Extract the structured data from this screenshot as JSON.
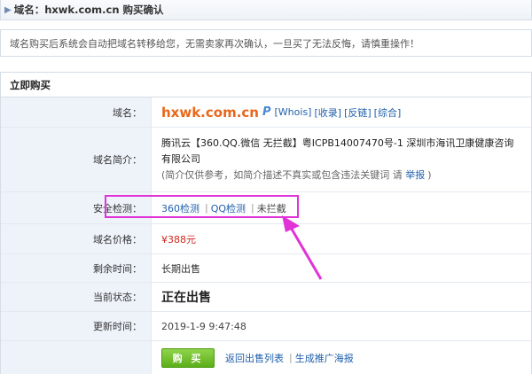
{
  "header": {
    "title": "域名：hxwk.com.cn 购买确认"
  },
  "notice": "域名购买后系统会自动把域名转移给您，无需卖家再次确认，一旦买了无法反悔，请慎重操作！",
  "panel": {
    "title": "立即购买"
  },
  "rows": {
    "domain": {
      "label": "域名：",
      "name": "hxwk.com.cn",
      "p_icon": "P",
      "links": [
        "[Whois]",
        "[收录]",
        "[反链]",
        "[综合]"
      ]
    },
    "intro": {
      "label": "域名简介：",
      "text": "腾讯云【360.QQ.微信 无拦截】粤ICPB14007470号-1 深圳市海讯卫康健康咨询有限公司",
      "note": "(简介仅供参考，如简介描述不真实或包含违法关键词 请",
      "report": "举报",
      "note_end": ")"
    },
    "security": {
      "label": "安全检测：",
      "check360": "360检测",
      "checkqq": "QQ检测",
      "status": "未拦截",
      "sep": "|"
    },
    "price": {
      "label": "域名价格：",
      "value": "¥388元"
    },
    "remaining": {
      "label": "剩余时间：",
      "value": "长期出售"
    },
    "state": {
      "label": "当前状态：",
      "value": "正在出售"
    },
    "updated": {
      "label": "更新时间：",
      "value": "2019-1-9 9:47:48"
    },
    "actions": {
      "buy": "购 买",
      "back": "返回出售列表",
      "sep": "|",
      "promo": "生成推广海报"
    }
  },
  "colors": {
    "accent": "#e8671b",
    "link": "#1f5faa",
    "highlight": "#e033d8",
    "button": "#5cae1a"
  }
}
